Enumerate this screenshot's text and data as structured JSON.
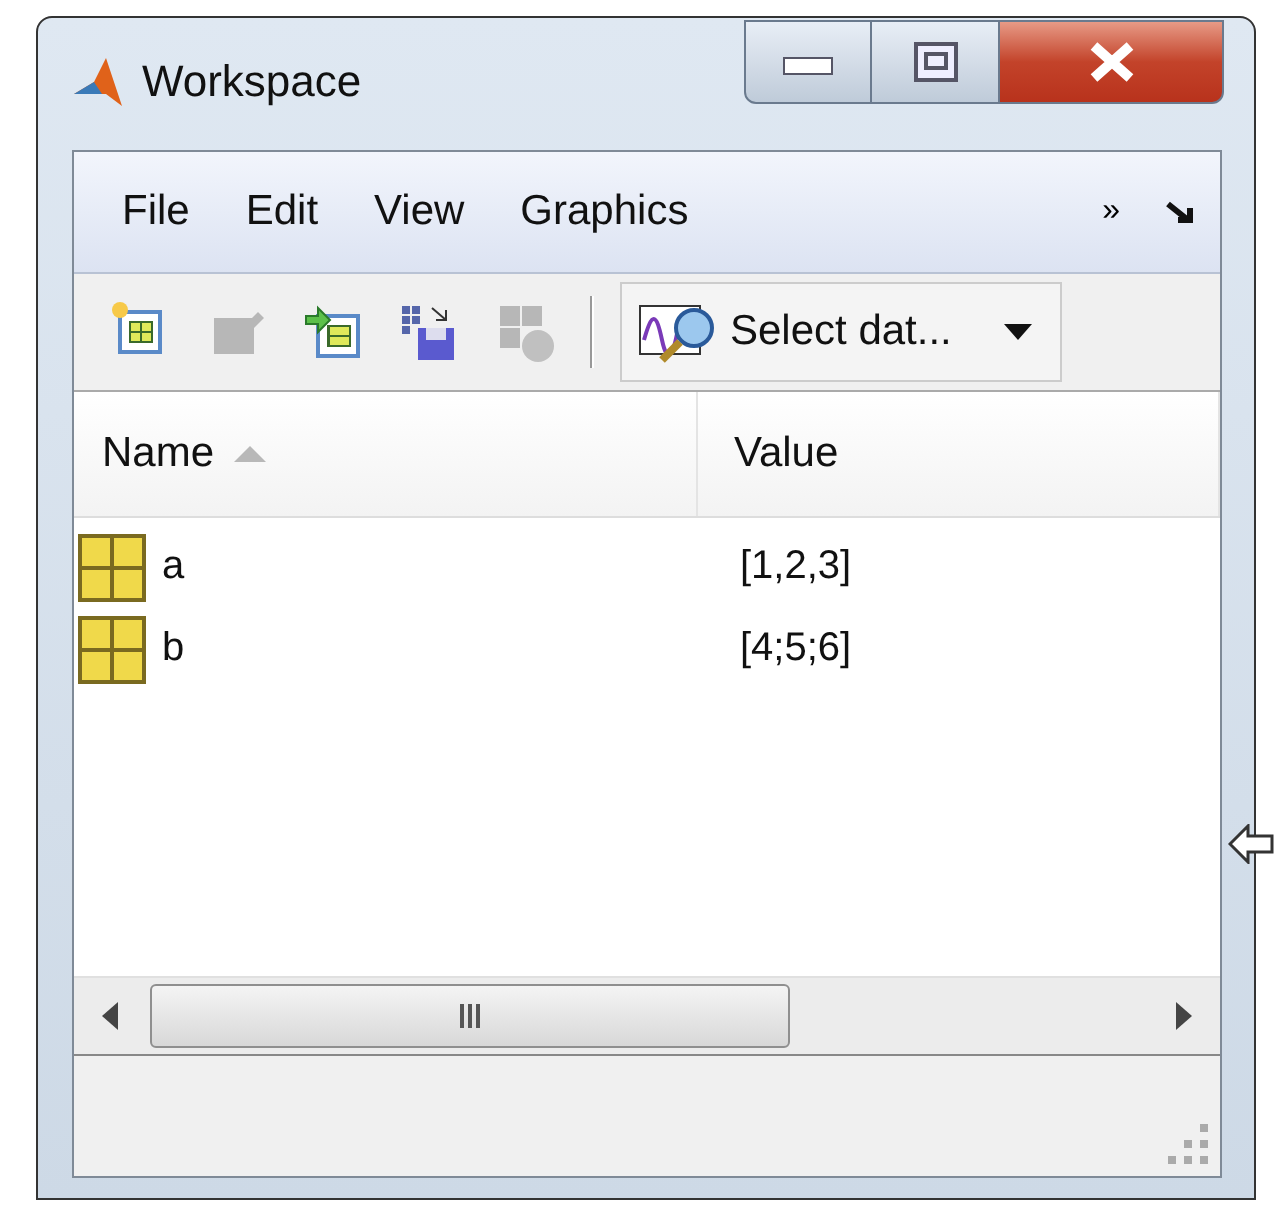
{
  "window": {
    "title": "Workspace"
  },
  "menu": [
    {
      "label": "File"
    },
    {
      "label": "Edit"
    },
    {
      "label": "View"
    },
    {
      "label": "Graphics"
    }
  ],
  "menu_overflow": "»",
  "toolbar": [
    {
      "kind": "new",
      "disabled": false
    },
    {
      "kind": "edit",
      "disabled": true
    },
    {
      "kind": "import",
      "disabled": false
    },
    {
      "kind": "save",
      "disabled": false
    },
    {
      "kind": "delete",
      "disabled": true
    }
  ],
  "select_data": {
    "label": "Select dat..."
  },
  "table": {
    "columns": [
      {
        "label": "Name",
        "sorted": true
      },
      {
        "label": "Value",
        "sorted": false
      }
    ],
    "rows": [
      {
        "name": "a",
        "value": "[1,2,3]"
      },
      {
        "name": "b",
        "value": "[4;5;6]"
      }
    ]
  }
}
